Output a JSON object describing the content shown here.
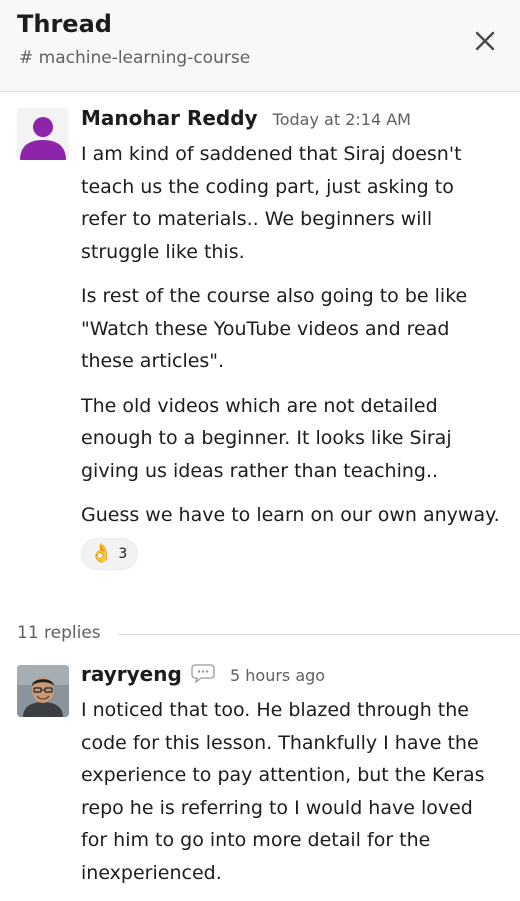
{
  "header": {
    "title": "Thread",
    "channel": "# machine-learning-course"
  },
  "messages": [
    {
      "author": "Manohar Reddy",
      "time": "Today at 2:14 AM",
      "paragraphs": [
        "I am kind of saddened that Siraj doesn't teach us the coding part, just asking to refer to materials.. We beginners will struggle like this.",
        "Is rest of the course also going to be like \"Watch these YouTube videos and read these articles\".",
        "The old videos which are not detailed enough to a beginner. It looks like Siraj giving us ideas rather than teaching..",
        "Guess we have to learn on our own anyway."
      ],
      "reaction": {
        "emoji": "👌",
        "count": "3"
      }
    },
    {
      "author": "rayryeng",
      "time": "5 hours ago",
      "paragraphs": [
        "I noticed that too. He blazed through the code for this lesson. Thankfully I have the experience to pay attention, but the Keras repo he is referring to I would have loved for him to go into more detail for the inexperienced."
      ]
    }
  ],
  "replies": {
    "label": "11 replies"
  },
  "colors": {
    "avatar_purple": "#8e24aa",
    "header_bg": "#f8f8f8"
  }
}
